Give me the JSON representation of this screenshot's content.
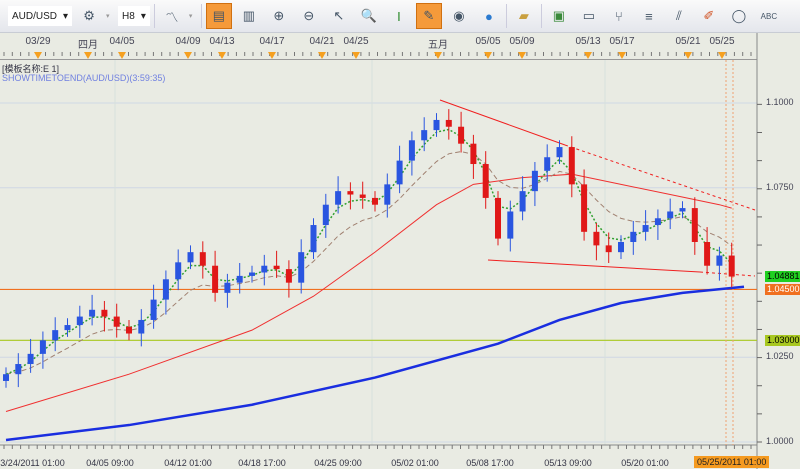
{
  "toolbar": {
    "symbol": "AUD/USD",
    "period": "H8",
    "icons": [
      "indicator-icon",
      "chart-type-icon",
      "bar-chart-icon",
      "candle-icon",
      "zoom-in-icon",
      "zoom-out-icon",
      "cursor-icon",
      "zoom-icon",
      "vertical-line-icon",
      "note-icon",
      "eye-icon",
      "globe-icon",
      "ruler-icon",
      "picture-icon",
      "window-icon",
      "fork-icon",
      "channel-icon",
      "fan-icon",
      "pen-icon",
      "ellipse-icon",
      "text-icon"
    ]
  },
  "top_axis": [
    "03/29",
    "四月",
    "04/05",
    "04/09",
    "04/13",
    "04/17",
    "04/21",
    "04/25",
    "五月",
    "05/05",
    "05/09",
    "05/13",
    "05/17",
    "05/21",
    "05/25"
  ],
  "legend": {
    "template": "[模板名称:E 1]",
    "indicator": "SHOWTIMETOEND(AUD/USD)(3:59:35)"
  },
  "bottom_axis": [
    "03/24/2011 01:00",
    "04/05 09:00",
    "04/12 01:00",
    "04/18 17:00",
    "04/25 09:00",
    "05/02 01:00",
    "05/08 17:00",
    "05/13 09:00",
    "05/20 01:00"
  ],
  "current_time_label": "05/25/2011 01:00",
  "price_labels": {
    "current": "1.04881",
    "orange_line": "1.04500",
    "green_line": "1.03000"
  },
  "chart_data": {
    "type": "candlestick",
    "symbol": "AUD/USD",
    "period": "H8",
    "yticks": [
      "1.1000",
      "1.0750",
      "1.0250",
      "1.0000"
    ],
    "ylim": [
      1.0,
      1.1
    ],
    "closes": [
      1.02,
      1.023,
      1.026,
      1.03,
      1.033,
      1.0345,
      1.037,
      1.039,
      1.037,
      1.034,
      1.032,
      1.036,
      1.042,
      1.048,
      1.053,
      1.056,
      1.052,
      1.044,
      1.047,
      1.049,
      1.05,
      1.052,
      1.051,
      1.047,
      1.056,
      1.064,
      1.07,
      1.074,
      1.073,
      1.072,
      1.07,
      1.076,
      1.083,
      1.089,
      1.092,
      1.095,
      1.093,
      1.088,
      1.082,
      1.072,
      1.06,
      1.068,
      1.074,
      1.08,
      1.084,
      1.087,
      1.076,
      1.062,
      1.058,
      1.056,
      1.059,
      1.062,
      1.064,
      1.066,
      1.068,
      1.069,
      1.059,
      1.052,
      1.055,
      1.0488
    ],
    "first_open": 1.018,
    "horizontal_lines": [
      {
        "price": 1.045,
        "color": "#f07020"
      },
      {
        "price": 1.03,
        "color": "#a8c820"
      }
    ],
    "ma_long": [
      [
        0,
        1.0006
      ],
      [
        10,
        1.005
      ],
      [
        20,
        1.011
      ],
      [
        30,
        1.019
      ],
      [
        40,
        1.029
      ],
      [
        45,
        1.036
      ],
      [
        50,
        1.041
      ],
      [
        55,
        1.044
      ],
      [
        60,
        1.0458
      ]
    ],
    "ma_mid": [
      [
        0,
        1.009
      ],
      [
        10,
        1.02
      ],
      [
        20,
        1.033
      ],
      [
        25,
        1.043
      ],
      [
        30,
        1.056
      ],
      [
        35,
        1.07
      ],
      [
        38,
        1.076
      ],
      [
        42,
        1.078
      ],
      [
        46,
        1.079
      ],
      [
        50,
        1.076
      ],
      [
        54,
        1.073
      ],
      [
        58,
        1.07
      ],
      [
        59,
        1.069
      ]
    ],
    "colors": {
      "up": "#2a55e0",
      "down": "#e01818",
      "ma_long": "#1a2ee0",
      "ma_mid": "#f03030",
      "ema_fast": "#30a030",
      "ema_slow": "#a08070"
    }
  }
}
